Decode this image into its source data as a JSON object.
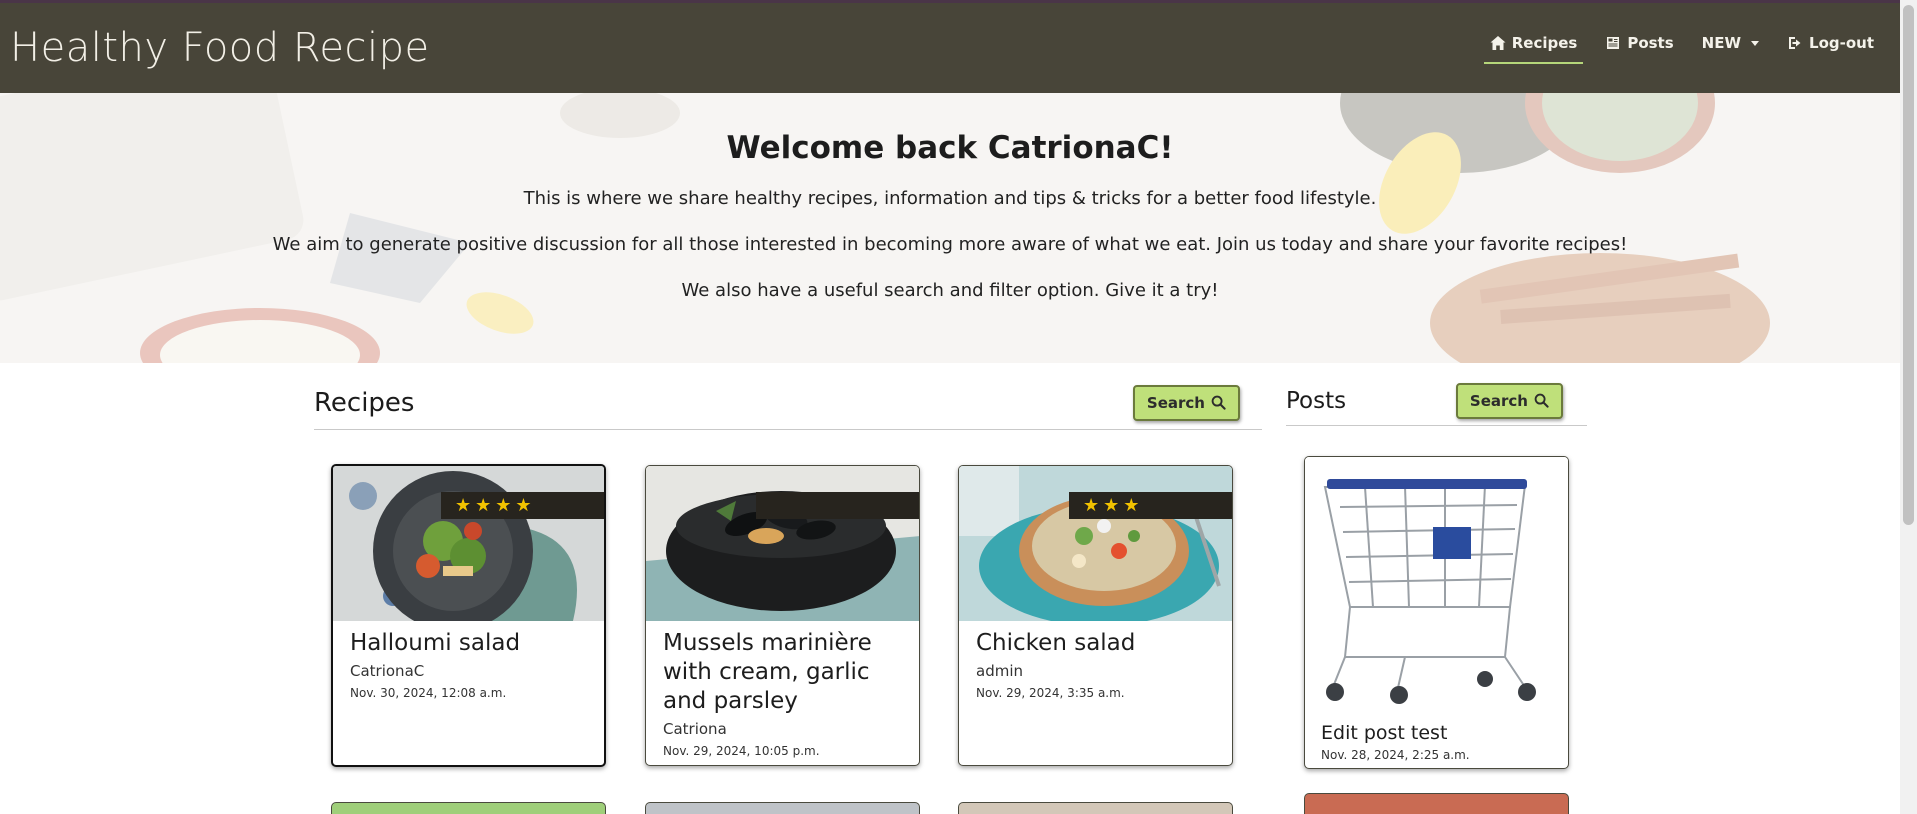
{
  "brand": "Healthy Food Recipe",
  "nav": {
    "items": [
      {
        "label": "Recipes",
        "icon": "home-icon",
        "active": true
      },
      {
        "label": "Posts",
        "icon": "newspaper-icon"
      },
      {
        "label": "NEW",
        "icon": "caret-down-icon"
      },
      {
        "label": "Log-out",
        "icon": "sign-out-icon"
      }
    ]
  },
  "hero": {
    "title": "Welcome back CatrionaC!",
    "line1": "This is where we share healthy recipes, information and tips & tricks for a better food lifestyle.",
    "line2": "We aim to generate positive discussion for all those interested in becoming more aware of what we eat. Join us today and share your favorite recipes!",
    "line3": "We also have a useful search and filter option. Give it a try!"
  },
  "recipes": {
    "heading": "Recipes",
    "search_label": "Search",
    "cards": [
      {
        "title": "Halloumi salad",
        "author": "CatrionaC",
        "date": "Nov. 30, 2024, 12:08 a.m.",
        "stars": 4
      },
      {
        "title": "Mussels marinière with cream, garlic and parsley",
        "author": "Catriona",
        "date": "Nov. 29, 2024, 10:05 p.m.",
        "stars": 0
      },
      {
        "title": "Chicken salad",
        "author": "admin",
        "date": "Nov. 29, 2024, 3:35 a.m.",
        "stars": 3
      }
    ]
  },
  "posts": {
    "heading": "Posts",
    "search_label": "Search",
    "cards": [
      {
        "title": "Edit post test",
        "date": "Nov. 28, 2024, 2:25 a.m."
      }
    ]
  },
  "colors": {
    "navbar": "#484539",
    "accent": "#bfe07a",
    "star": "#f2c200"
  }
}
